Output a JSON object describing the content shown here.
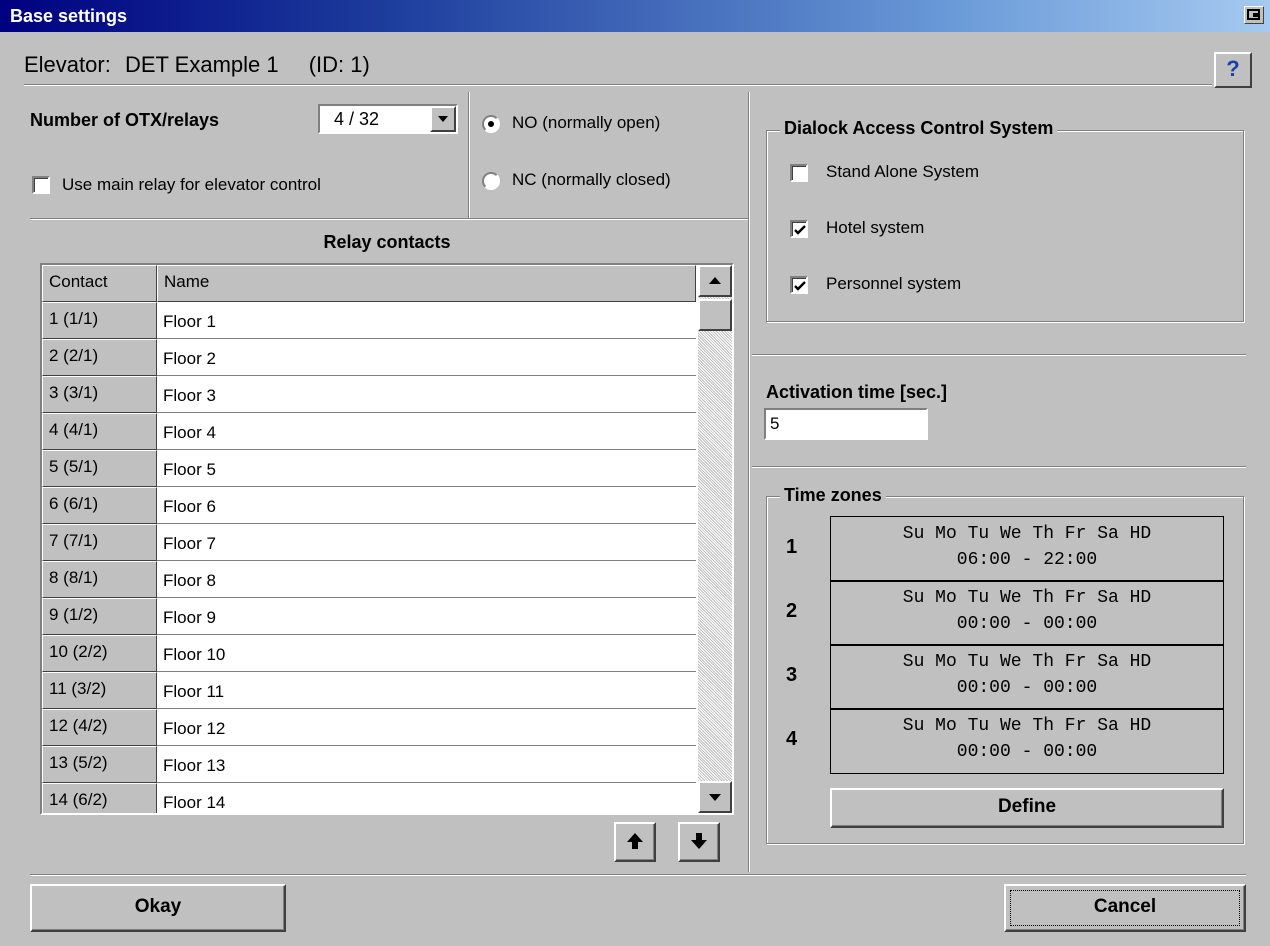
{
  "window": {
    "title": "Base settings"
  },
  "header": {
    "elevator_label": "Elevator:",
    "elevator_name": "DET Example 1",
    "id_text": "(ID: 1)",
    "help_glyph": "?"
  },
  "relays": {
    "count_label": "Number of OTX/relays",
    "count_value": "4 / 32",
    "use_main_relay_label": "Use main relay for elevator control",
    "use_main_relay_checked": false,
    "mode_options": [
      "NO (normally open)",
      "NC (normally closed)"
    ],
    "mode_selected": "NO (normally open)"
  },
  "relay_contacts": {
    "title": "Relay contacts",
    "columns": [
      "Contact",
      "Name"
    ],
    "rows": [
      {
        "contact": "1 (1/1)",
        "name": "Floor 1"
      },
      {
        "contact": "2 (2/1)",
        "name": "Floor 2"
      },
      {
        "contact": "3 (3/1)",
        "name": "Floor 3"
      },
      {
        "contact": "4 (4/1)",
        "name": "Floor 4"
      },
      {
        "contact": "5 (5/1)",
        "name": "Floor 5"
      },
      {
        "contact": "6 (6/1)",
        "name": "Floor 6"
      },
      {
        "contact": "7 (7/1)",
        "name": "Floor 7"
      },
      {
        "contact": "8 (8/1)",
        "name": "Floor 8"
      },
      {
        "contact": "9 (1/2)",
        "name": "Floor 9"
      },
      {
        "contact": "10 (2/2)",
        "name": "Floor 10"
      },
      {
        "contact": "11 (3/2)",
        "name": "Floor 11"
      },
      {
        "contact": "12 (4/2)",
        "name": "Floor 12"
      },
      {
        "contact": "13 (5/2)",
        "name": "Floor 13"
      },
      {
        "contact": "14 (6/2)",
        "name": "Floor 14"
      }
    ]
  },
  "access_control": {
    "title": "Dialock Access Control System",
    "options": [
      {
        "label": "Stand Alone System",
        "checked": false
      },
      {
        "label": "Hotel system",
        "checked": true
      },
      {
        "label": "Personnel system",
        "checked": true
      }
    ]
  },
  "activation": {
    "label": "Activation time [sec.]",
    "value": "5"
  },
  "time_zones": {
    "title": "Time zones",
    "zones": [
      {
        "num": "1",
        "days": "Su Mo Tu We Th Fr Sa HD",
        "range": "06:00 - 22:00"
      },
      {
        "num": "2",
        "days": "Su Mo Tu We Th Fr Sa HD",
        "range": "00:00 - 00:00"
      },
      {
        "num": "3",
        "days": "Su Mo Tu We Th Fr Sa HD",
        "range": "00:00 - 00:00"
      },
      {
        "num": "4",
        "days": "Su Mo Tu We Th Fr Sa HD",
        "range": "00:00 - 00:00"
      }
    ],
    "define_label": "Define"
  },
  "footer": {
    "okay_label": "Okay",
    "cancel_label": "Cancel"
  }
}
